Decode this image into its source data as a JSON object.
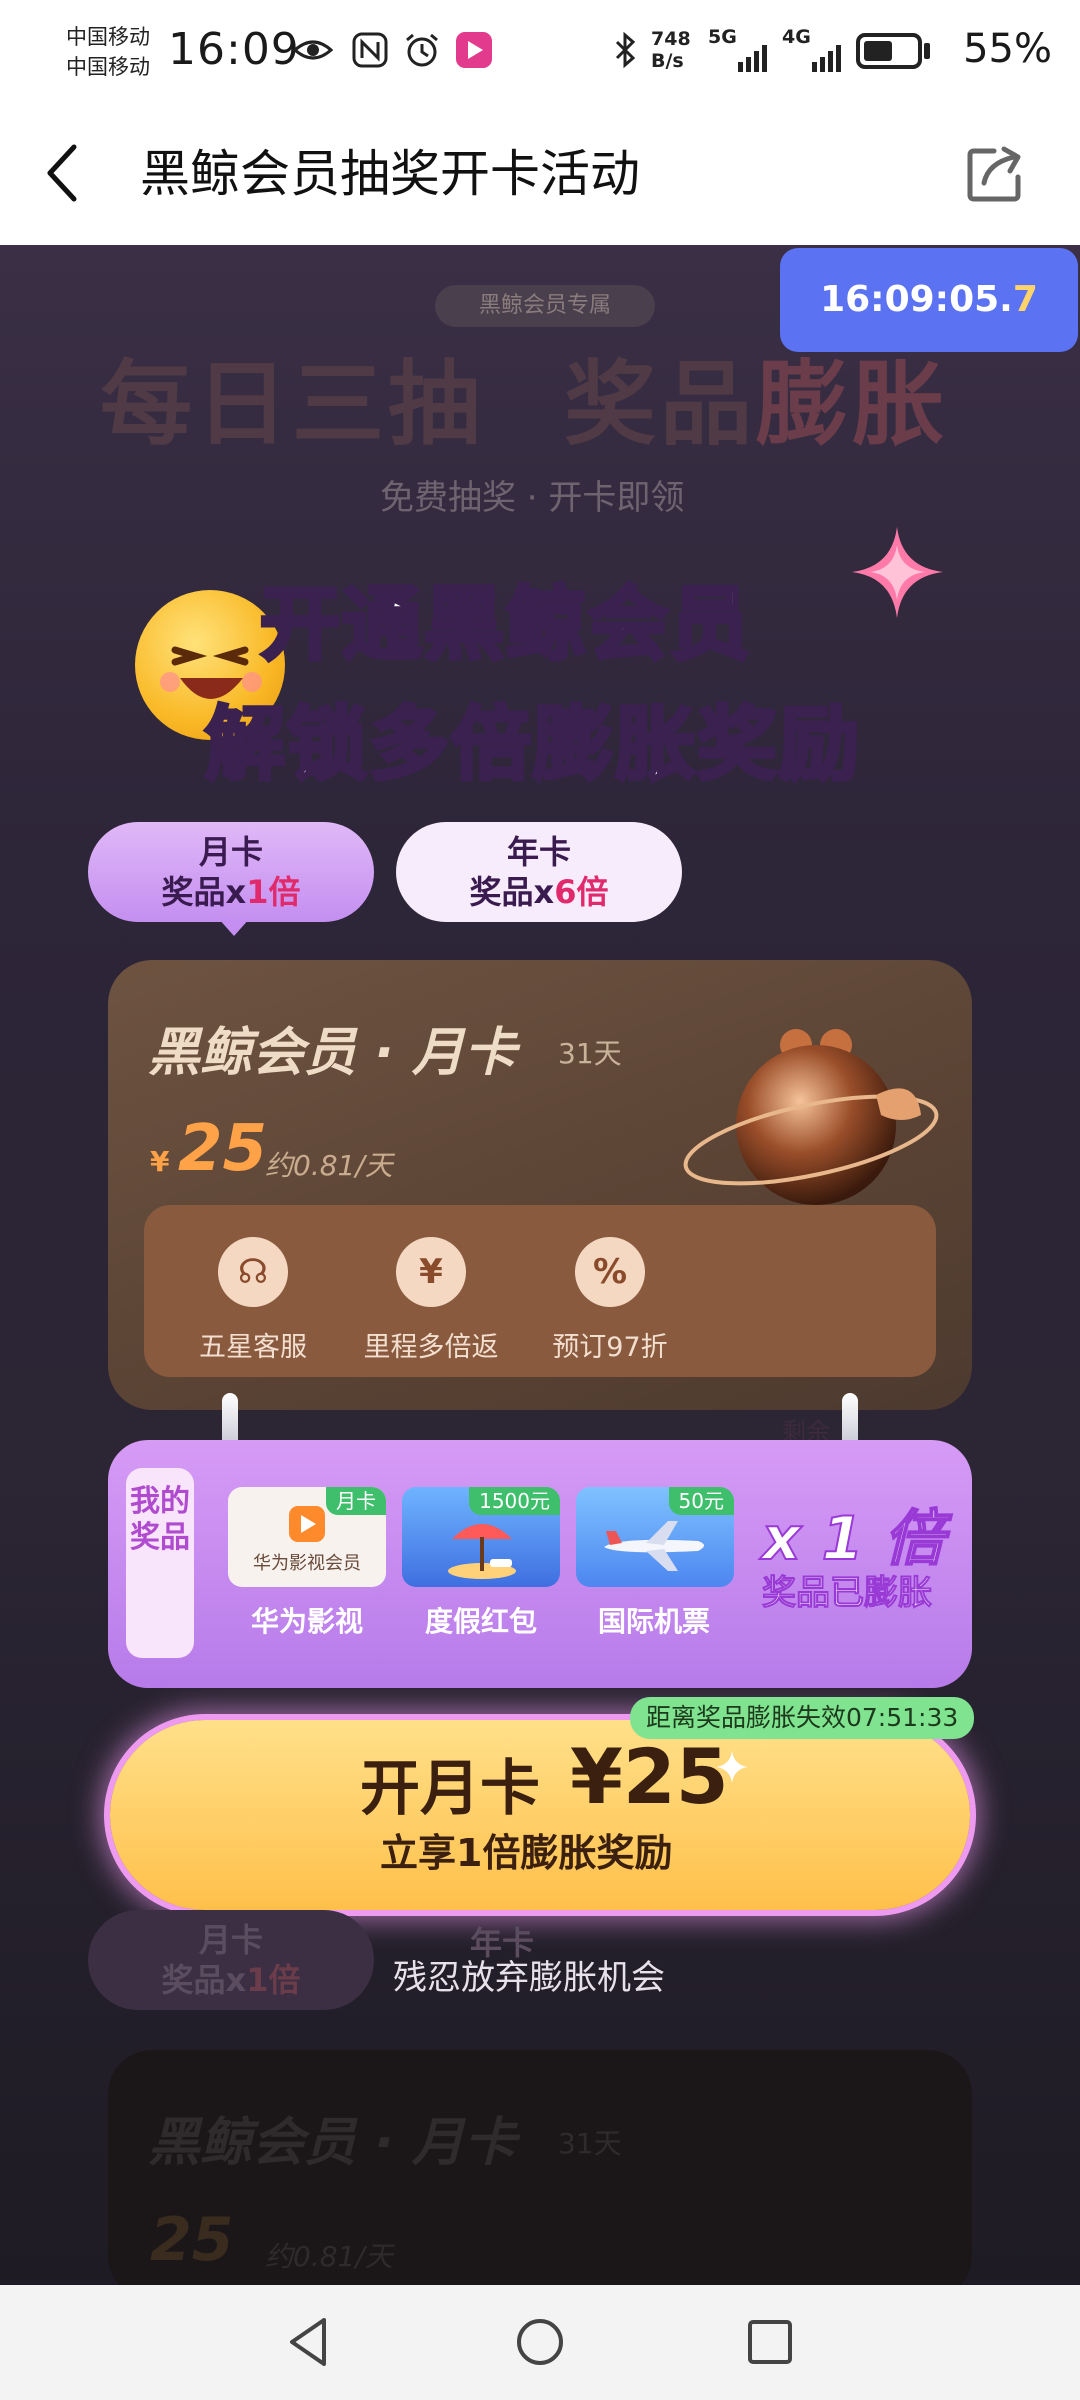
{
  "status_bar": {
    "carrier_1": "中国移动",
    "carrier_2": "中国移动",
    "time": "16:09",
    "net_speed_1": "748",
    "net_speed_2": "B/s",
    "signal_1": "5G",
    "signal_2": "4G",
    "battery": "55%",
    "battery_level": 0.55
  },
  "header": {
    "title": "黑鲸会员抽奖开卡活动"
  },
  "timer": {
    "main": "16:09:05.",
    "last_digit": "7"
  },
  "promo": {
    "badge": "黑鲸会员专属",
    "big_a": "每日三抽",
    "big_b": "奖品",
    "big_c": "膨胀",
    "sub": "免费抽奖 · 开卡即领",
    "headline_1": "开通黑鲸会员",
    "headline_2": "解锁多倍膨胀奖励"
  },
  "tabs": [
    {
      "line1": "月卡",
      "line2_prefix": "奖品x",
      "line2_value": "1倍"
    },
    {
      "line1": "年卡",
      "line2_prefix": "奖品x",
      "line2_value": "6倍"
    }
  ],
  "card": {
    "title": "黑鲸会员 · 月卡",
    "days": "31天",
    "currency": "¥",
    "price": "25",
    "per_day": "约0.81/天",
    "perks": [
      {
        "icon": "headset",
        "glyph": "☊",
        "label": "五星客服"
      },
      {
        "icon": "yuan",
        "glyph": "¥",
        "label": "里程多倍返"
      },
      {
        "icon": "discount",
        "glyph": "%",
        "label": "预订97折"
      }
    ]
  },
  "my_prizes": {
    "label": "我的奖品",
    "remaining": "剩余",
    "items": [
      {
        "tag": "月卡",
        "image_text": "华为影视会员",
        "label": "华为影视"
      },
      {
        "tag": "1500元",
        "image_text": "",
        "label": "度假红包"
      },
      {
        "tag": "50元",
        "image_text": "",
        "label": "国际机票"
      }
    ],
    "multiplier": "x 1 倍",
    "multiplier_sub": "奖品已膨胀"
  },
  "cta": {
    "expire": "距离奖品膨胀失效07:51:33",
    "main": "开月卡",
    "price": "¥25",
    "sub": "立享1倍膨胀奖励"
  },
  "give_up": "残忍放弃膨胀机会",
  "colors": {
    "accent_blue": "#5b72f2",
    "price_orange": "#ffa248",
    "cta_yellow": "#ffc04a",
    "prize_purple": "#c48ff0"
  }
}
